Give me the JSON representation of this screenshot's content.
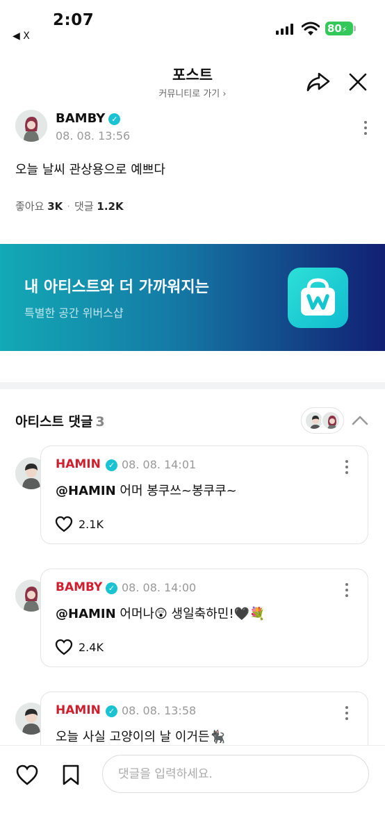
{
  "status_bar": {
    "time": "2:07",
    "back_app": "◀ X",
    "battery": "80"
  },
  "header": {
    "title": "포스트",
    "subtitle": "커뮤니티로 가기 ›"
  },
  "post": {
    "author": "BAMBY",
    "date": "08. 08. 13:56",
    "body": "오늘 날씨 관상용으로 예쁘다",
    "likes_label": "좋아요",
    "likes": "3K",
    "comments_label": "댓글",
    "comments": "1.2K"
  },
  "banner": {
    "title": "내 아티스트와 더 가까워지는",
    "subtitle": "특별한 공간 위버스샵"
  },
  "artist_comments": {
    "title": "아티스트 댓글",
    "count": "3",
    "items": [
      {
        "author": "HAMIN",
        "date": "08. 08. 14:01",
        "mention": "@HAMIN",
        "text": " 어머 봉쿠쓰~봉쿠쿠~",
        "likes": "2.1K"
      },
      {
        "author": "BAMBY",
        "date": "08. 08. 14:00",
        "mention": "@HAMIN",
        "text": " 어머나😲 생일축하민!🖤💐",
        "likes": "2.4K"
      },
      {
        "author": "HAMIN",
        "date": "08. 08. 13:58",
        "mention": "",
        "text": "오늘 사실 고양이의 날 이거든🐈‍⬛",
        "likes": ""
      }
    ]
  },
  "bottom_bar": {
    "comment_placeholder": "댓글을 입력하세요."
  },
  "colors": {
    "accent_red": "#d01e2e",
    "verified": "#19c3d2",
    "battery": "#34c759"
  }
}
